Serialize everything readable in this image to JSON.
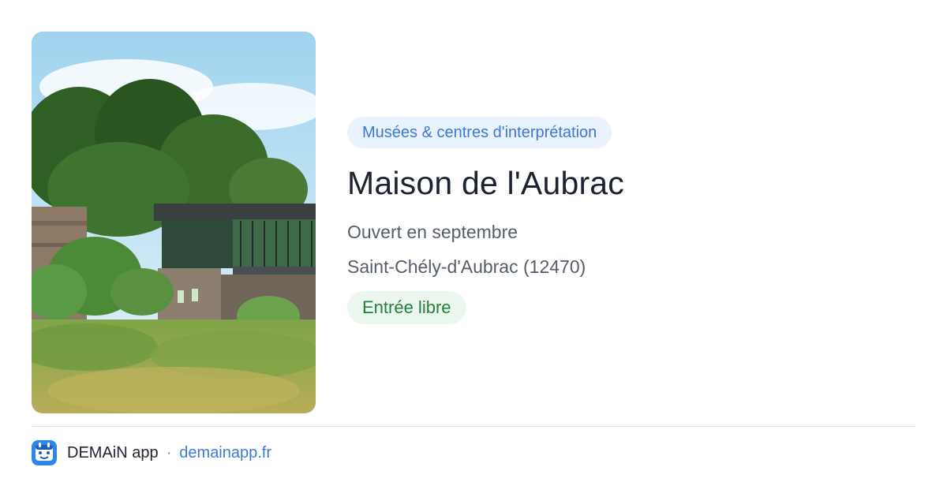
{
  "event": {
    "category": "Musées & centres d'interprétation",
    "title": "Maison de l'Aubrac",
    "opening": "Ouvert en septembre",
    "location": "Saint-Chély-d'Aubrac (12470)",
    "price": "Entrée libre"
  },
  "footer": {
    "app_name": "DEMAiN app",
    "separator": "·",
    "url": "demainapp.fr"
  },
  "icons": {
    "app_icon": "demain-app-icon",
    "photo": "building-photo"
  },
  "colors": {
    "accent": "#3a7ad6",
    "category_bg": "#eaf2fd",
    "entry_text": "#25803f",
    "entry_bg": "#ebf7ee",
    "title": "#1b2230"
  }
}
